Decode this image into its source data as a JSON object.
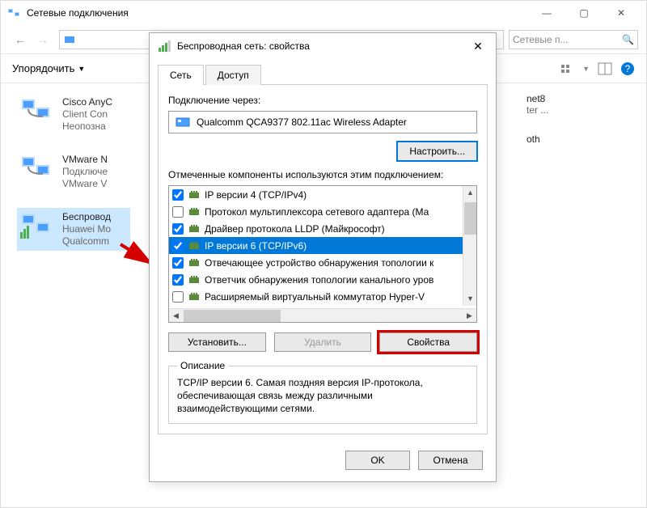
{
  "parent": {
    "title": "Сетевые подключения",
    "breadcrumb_icon": "network-icon",
    "search_placeholder": "Сетевые п...",
    "organize_label": "Упорядочить",
    "connections": [
      {
        "name": "Cisco AnyC",
        "line2": "Client Con",
        "line3": "Неопозна"
      },
      {
        "name": "VMware N",
        "line2": "Подключе",
        "line3": "VMware V"
      },
      {
        "name": "Беспровод",
        "line2": "Huawei Mo",
        "line3": "Qualcomm"
      }
    ],
    "side_items": [
      {
        "text": "net8",
        "sub": "ter ..."
      },
      {
        "text": "oth"
      }
    ]
  },
  "dialog": {
    "title": "Беспроводная сеть: свойства",
    "tabs": {
      "network": "Сеть",
      "access": "Доступ"
    },
    "connect_via_label": "Подключение через:",
    "adapter_name": "Qualcomm QCA9377 802.11ac Wireless Adapter",
    "configure_btn": "Настроить...",
    "components_label": "Отмеченные компоненты используются этим подключением:",
    "components": [
      {
        "checked": true,
        "label": "IP версии 4 (TCP/IPv4)",
        "selected": false
      },
      {
        "checked": false,
        "label": "Протокол мультиплексора сетевого адаптера (Ма",
        "selected": false
      },
      {
        "checked": true,
        "label": "Драйвер протокола LLDP (Майкрософт)",
        "selected": false
      },
      {
        "checked": true,
        "label": "IP версии 6 (TCP/IPv6)",
        "selected": true
      },
      {
        "checked": true,
        "label": "Отвечающее устройство обнаружения топологии к",
        "selected": false
      },
      {
        "checked": true,
        "label": "Ответчик обнаружения топологии канального уров",
        "selected": false
      },
      {
        "checked": false,
        "label": "Расширяемый виртуальный коммутатор Hyper-V",
        "selected": false
      }
    ],
    "install_btn": "Установить...",
    "uninstall_btn": "Удалить",
    "properties_btn": "Свойства",
    "desc_label": "Описание",
    "desc_text": "TCP/IP версии 6. Самая поздняя версия IP-протокола, обеспечивающая связь между различными взаимодействующими сетями.",
    "ok_btn": "OK",
    "cancel_btn": "Отмена"
  }
}
